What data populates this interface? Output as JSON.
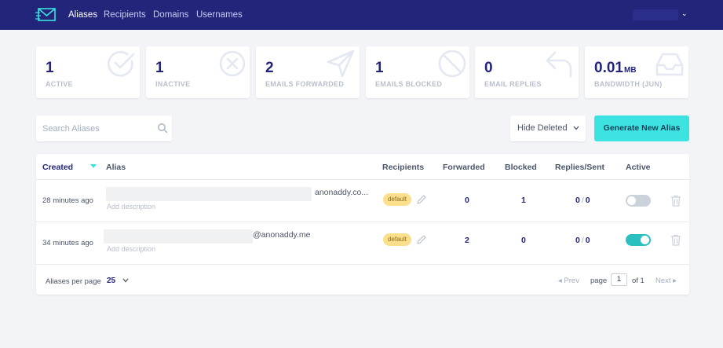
{
  "nav": {
    "links": [
      "Aliases",
      "Recipients",
      "Domains",
      "Usernames"
    ],
    "user_chevron": "⌄"
  },
  "stats": [
    {
      "value": "1",
      "unit": "",
      "label": "ACTIVE",
      "icon": "check-circle-icon"
    },
    {
      "value": "1",
      "unit": "",
      "label": "INACTIVE",
      "icon": "x-circle-icon"
    },
    {
      "value": "2",
      "unit": "",
      "label": "EMAILS FORWARDED",
      "icon": "send-icon"
    },
    {
      "value": "1",
      "unit": "",
      "label": "EMAILS BLOCKED",
      "icon": "slash-circle-icon"
    },
    {
      "value": "0",
      "unit": "",
      "label": "EMAIL REPLIES",
      "icon": "reply-icon"
    },
    {
      "value": "0.01",
      "unit": "MB",
      "label": "BANDWIDTH (JUN)",
      "icon": "inbox-icon"
    }
  ],
  "search": {
    "placeholder": "Search Aliases"
  },
  "filter": {
    "selected": "Hide Deleted"
  },
  "generate_button": "Generate New Alias",
  "table": {
    "headers": [
      "Created",
      "Alias",
      "Recipients",
      "Forwarded",
      "Blocked",
      "Replies/Sent",
      "Active"
    ],
    "rows": [
      {
        "created": "28 minutes ago",
        "alias_domain": "anonaddy.co...",
        "description": "Add description",
        "recipient": "default",
        "forwarded": "0",
        "blocked": "1",
        "replies": "0",
        "sent": "0",
        "active": false
      },
      {
        "created": "34 minutes ago",
        "alias_domain": "@anonaddy.me",
        "description": "Add description",
        "recipient": "default",
        "forwarded": "2",
        "blocked": "0",
        "replies": "0",
        "sent": "0",
        "active": true
      }
    ]
  },
  "pagination": {
    "per_page_label": "Aliases per page",
    "per_page_value": "25",
    "prev": "◂ Prev",
    "page_label": "page",
    "page_value": "1",
    "of_label": "of 1",
    "next": "Next ▸"
  },
  "colors": {
    "nav_bg": "#22257a",
    "accent": "#3de3e0",
    "toggle_on": "#2bc0c0"
  }
}
